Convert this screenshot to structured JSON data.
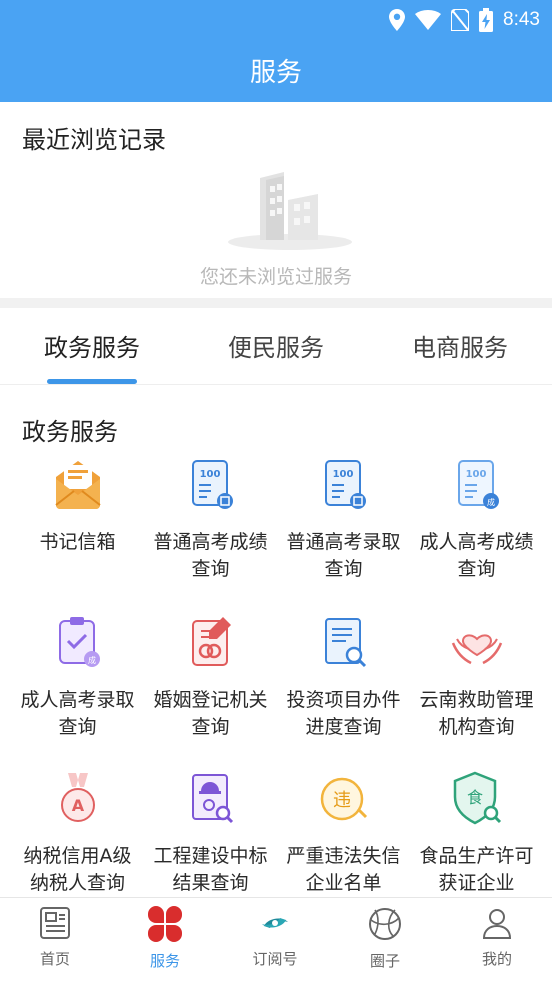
{
  "status_bar": {
    "time": "8:43"
  },
  "header": {
    "title": "服务"
  },
  "recent": {
    "title": "最近浏览记录",
    "empty_text": "您还未浏览过服务"
  },
  "tabs": [
    {
      "label": "政务服务",
      "active": true
    },
    {
      "label": "便民服务",
      "active": false
    },
    {
      "label": "电商服务",
      "active": false
    }
  ],
  "section": {
    "title": "政务服务"
  },
  "services": [
    {
      "label": "书记信箱",
      "icon": "mailbox-icon"
    },
    {
      "label": "普通高考成绩查询",
      "icon": "score-report-icon"
    },
    {
      "label": "普通高考录取查询",
      "icon": "admission-report-icon"
    },
    {
      "label": "成人高考成绩查询",
      "icon": "adult-score-icon"
    },
    {
      "label": "成人高考录取查询",
      "icon": "adult-admission-icon"
    },
    {
      "label": "婚姻登记机关查询",
      "icon": "marriage-registry-icon"
    },
    {
      "label": "投资项目办件进度查询",
      "icon": "document-search-icon"
    },
    {
      "label": "云南救助管理机构查询",
      "icon": "heart-hands-icon"
    },
    {
      "label": "纳税信用A级纳税人查询",
      "icon": "medal-a-icon"
    },
    {
      "label": "工程建设中标结果查询",
      "icon": "engineering-search-icon"
    },
    {
      "label": "严重违法失信企业名单",
      "icon": "violation-icon"
    },
    {
      "label": "食品生产许可获证企业",
      "icon": "food-shield-icon"
    }
  ],
  "bottom_nav": [
    {
      "label": "首页",
      "icon": "news-icon",
      "active": false
    },
    {
      "label": "服务",
      "icon": "clover-icon",
      "active": true
    },
    {
      "label": "订阅号",
      "icon": "subscribe-icon",
      "active": false
    },
    {
      "label": "圈子",
      "icon": "circle-icon",
      "active": false
    },
    {
      "label": "我的",
      "icon": "person-icon",
      "active": false
    }
  ],
  "colors": {
    "header_bg": "#4aa3f3",
    "accent": "#3d96e8",
    "nav_active_icon": "#d92d2d"
  }
}
